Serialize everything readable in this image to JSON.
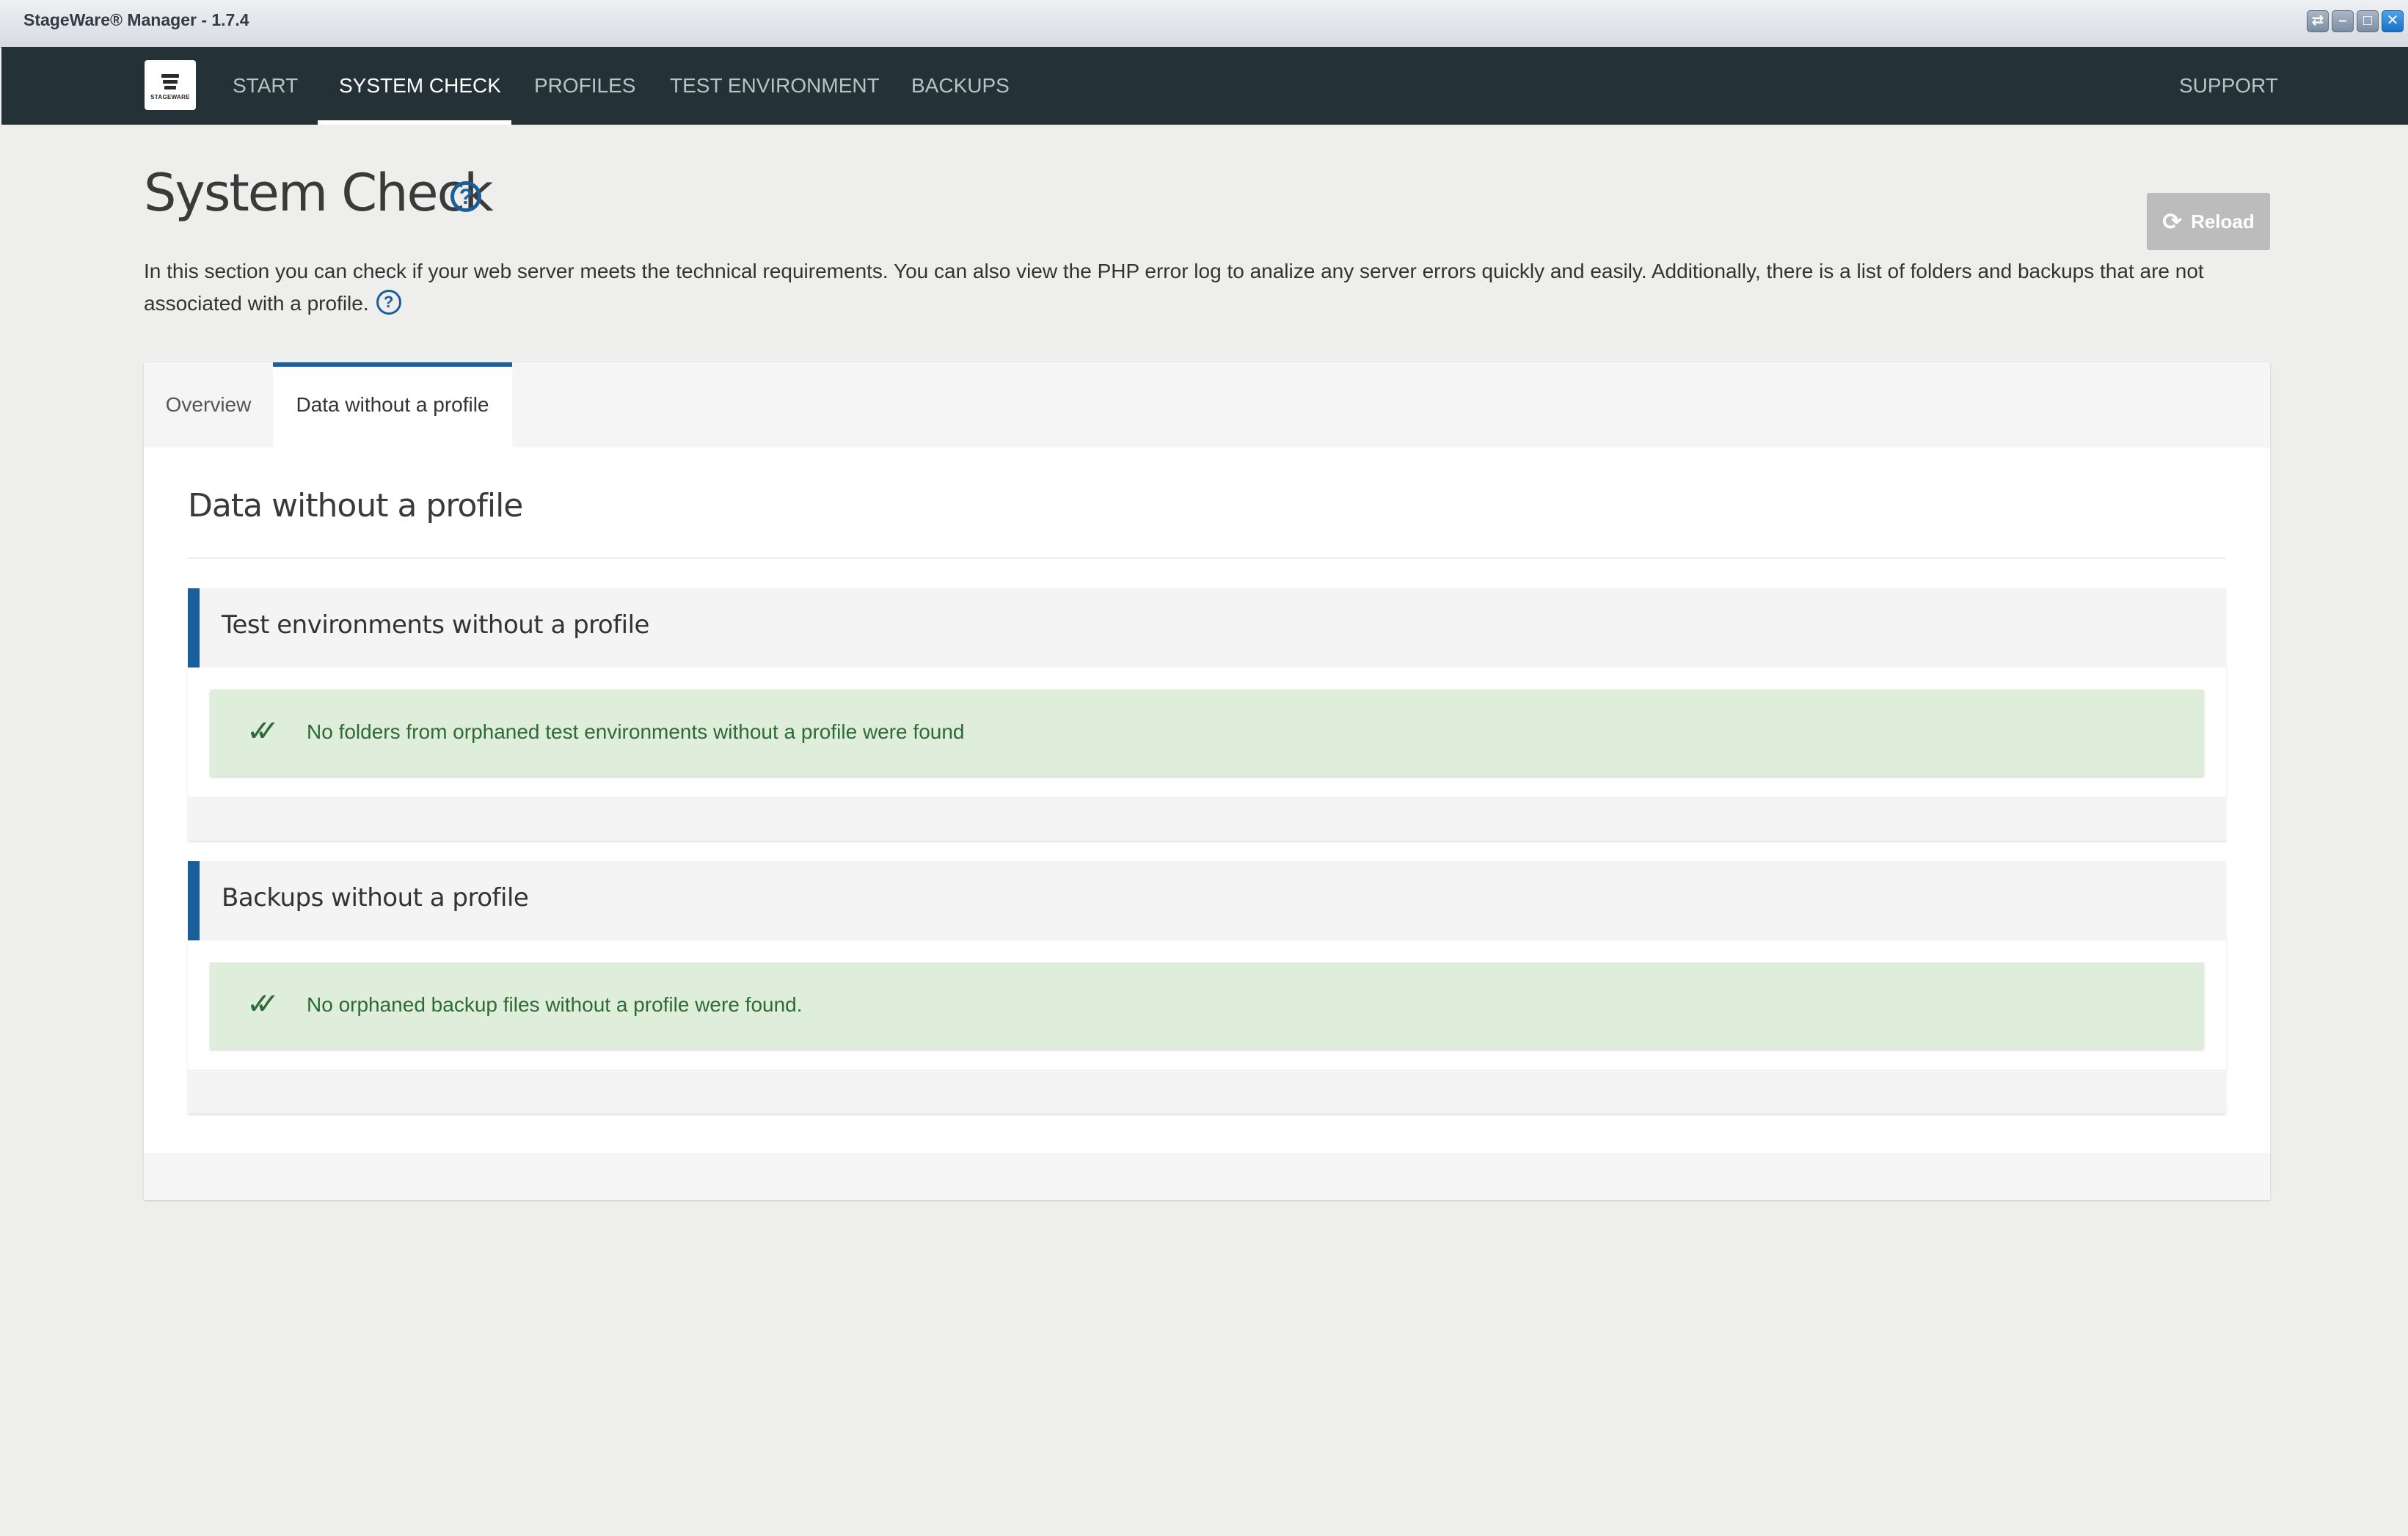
{
  "window": {
    "title": "StageWare® Manager - 1.7.4",
    "controls": [
      "restore-icon",
      "minimize-icon",
      "maximize-icon",
      "close-icon"
    ]
  },
  "nav": {
    "logo_text": "STAGEWARE",
    "items": [
      "START",
      "SYSTEM CHECK",
      "PROFILES",
      "TEST ENVIRONMENT",
      "BACKUPS"
    ],
    "active": "SYSTEM CHECK",
    "support": "SUPPORT"
  },
  "page": {
    "title": "System Check",
    "reload_label": "Reload",
    "intro": "In this section you can check if your web server meets the technical requirements. You can also view the PHP error log to analize any server errors quickly and easily. Additionally, there is a list of folders and backups that are not associated with a profile."
  },
  "tabs": [
    "Overview",
    "Data without a profile"
  ],
  "active_tab": "Data without a profile",
  "section": {
    "title": "Data without a profile",
    "cards": [
      {
        "title": "Test environments without a profile",
        "message": "No folders from orphaned test environments without a profile were found"
      },
      {
        "title": "Backups without a profile",
        "message": "No orphaned backup files without a profile were found."
      }
    ]
  },
  "colors": {
    "nav_bg": "#243238",
    "accent": "#1a5e9a",
    "success_bg": "#dfeedb",
    "success_text": "#2e6a36",
    "page_bg": "#eeeeed"
  }
}
